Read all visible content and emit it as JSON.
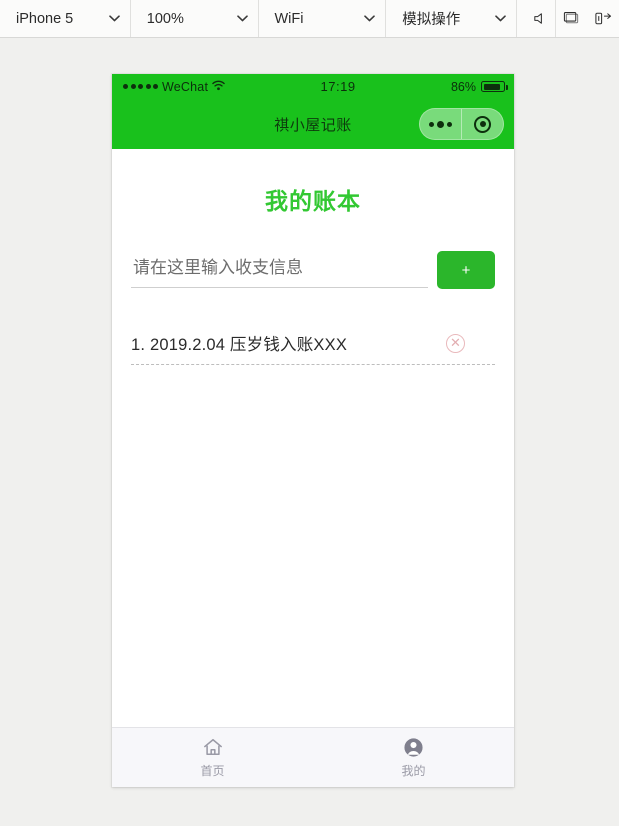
{
  "toolbar": {
    "device": {
      "label": "iPhone 5",
      "icon": "chevron-down-icon"
    },
    "zoom": {
      "label": "100%",
      "icon": "chevron-down-icon"
    },
    "network": {
      "label": "WiFi",
      "icon": "chevron-down-icon"
    },
    "simulate": {
      "label": "模拟操作",
      "icon": "chevron-down-icon"
    },
    "icons": [
      "speaker-icon",
      "screen-icon",
      "rotate-device-icon"
    ]
  },
  "phone": {
    "statusbar": {
      "signal_dots": 5,
      "carrier": "WeChat",
      "wifi_icon": "wifi-icon",
      "time": "17:19",
      "battery_percent": "86%",
      "battery_icon": "battery-icon"
    },
    "navbar": {
      "title": "祺小屋记账",
      "capsule": {
        "more_icon": "ellipsis-icon",
        "target_icon": "target-icon"
      }
    },
    "page": {
      "title": "我的账本",
      "input": {
        "value": "",
        "placeholder": "请在这里输入收支信息"
      },
      "add_button": {
        "label": "+",
        "icon": "plus-icon"
      },
      "entries": [
        {
          "text": "1. 2019.2.04 压岁钱入账XXX",
          "delete_icon": "circle-x-icon"
        }
      ]
    },
    "tabbar": {
      "tabs": [
        {
          "label": "首页",
          "icon": "home-icon",
          "active": false
        },
        {
          "label": "我的",
          "icon": "person-icon",
          "active": false
        }
      ]
    }
  },
  "colors": {
    "brand_green": "#19c11c",
    "title_green": "#32c832",
    "button_green": "#2bb62b",
    "page_background": "#f0f0ee",
    "tabbar_background": "#f7f7fa",
    "tab_label": "#9a9aa6",
    "delete_icon": "#e2aeb2"
  }
}
